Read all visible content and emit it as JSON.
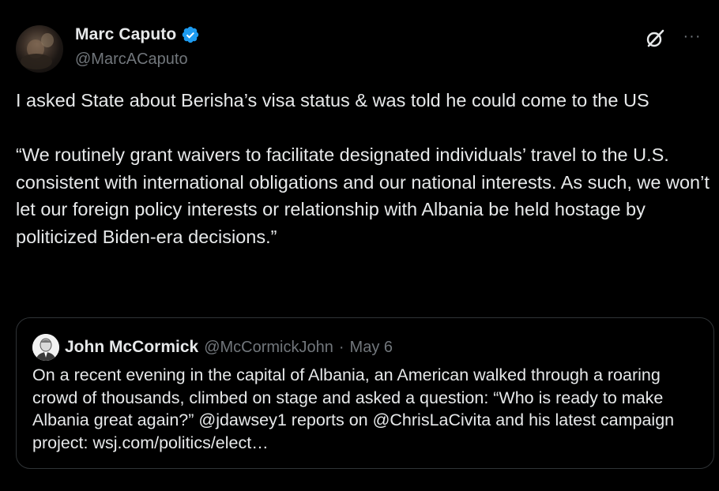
{
  "tweet": {
    "author": {
      "display_name": "Marc Caputo",
      "handle": "@MarcACaputo",
      "verified": true,
      "verified_color": "#1d9bf0"
    },
    "icons": {
      "grok": "grok-icon",
      "more": "more-options-icon"
    },
    "more_glyph": "···",
    "text": "I asked State about Berisha’s visa status & was told he could come to the US\n\n“We routinely grant waivers to facilitate designated individuals’ travel to the U.S. consistent with international obligations and our national interests. As such, we won’t let our foreign policy interests or relationship with Albania be held hostage by politicized Biden-era decisions.”"
  },
  "quote": {
    "author": {
      "display_name": "John McCormick",
      "handle": "@McCormickJohn"
    },
    "separator": "·",
    "date": "May 6",
    "text": "On a recent evening in the capital of Albania, an American walked through a roaring crowd of thousands, climbed on stage and asked a question: “Who is ready to make Albania great again?” @jdawsey1 reports on @ChrisLaCivita and his latest campaign project: wsj.com/politics/elect…"
  },
  "colors": {
    "background": "#000000",
    "text_primary": "#e7e9ea",
    "text_secondary": "#71767b",
    "border": "#2f3336",
    "accent": "#1d9bf0"
  }
}
